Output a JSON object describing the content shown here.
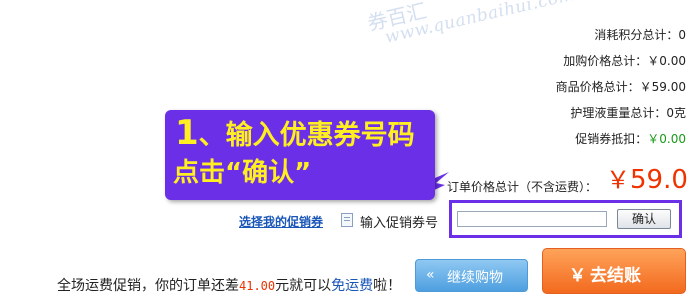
{
  "watermark": {
    "name": "券百汇",
    "url": "www.quanbaihui.com"
  },
  "summary": [
    {
      "label": "消耗积分总计：",
      "value": "0",
      "color": "#222222"
    },
    {
      "label": "加购价格总计：",
      "value": "￥0.00",
      "color": "#222222"
    },
    {
      "label": "商品价格总计：",
      "value": "￥59.00",
      "color": "#222222"
    },
    {
      "label": "护理液重量总计：",
      "value": "0克",
      "color": "#222222"
    },
    {
      "label": "促销券抵扣：",
      "value": "￥0.00",
      "color": "#1a9a1a"
    }
  ],
  "order_total": {
    "label": "订单价格总计（不含运费）：",
    "currency": "￥",
    "value": "59.0"
  },
  "callout": {
    "number": "1",
    "line1_rest": "、输入优惠券号码",
    "line2": "点击“确认”",
    "bg_color": "#6a2fe6",
    "text_color": "#ffee22"
  },
  "coupon": {
    "select_link": "选择我的促销券",
    "input_label": "输入促销券号",
    "input_value": "",
    "input_placeholder": "",
    "confirm_label": "确认"
  },
  "shipping": {
    "prefix": "全场运费促销，你的订单还差",
    "amount": "41.00",
    "middle": "元就可以",
    "free_text": "免运费",
    "suffix": "啦！"
  },
  "buttons": {
    "continue_icon": "«",
    "continue_label": "继续购物",
    "checkout_icon": "￥",
    "checkout_label": "去结账"
  }
}
